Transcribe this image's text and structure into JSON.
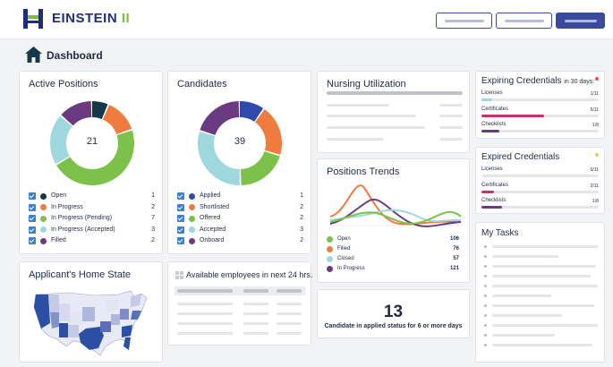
{
  "header": {
    "brand": "EINSTEIN",
    "brand_suffix": "II"
  },
  "page": {
    "title": "Dashboard"
  },
  "active_positions": {
    "title": "Active Positions",
    "total": "21",
    "items": [
      {
        "label": "Open",
        "value": "1",
        "color": "#14384a"
      },
      {
        "label": "In Progress",
        "value": "2",
        "color": "#ef7b3f"
      },
      {
        "label": "In Progress (Pending)",
        "value": "7",
        "color": "#7cc24a"
      },
      {
        "label": "In Progress (Accepted)",
        "value": "3",
        "color": "#9fd7df"
      },
      {
        "label": "Filled",
        "value": "2",
        "color": "#6b3a80"
      }
    ],
    "chart_data": {
      "type": "pie",
      "categories": [
        "Open",
        "In Progress",
        "In Progress (Pending)",
        "In Progress (Accepted)",
        "Filled"
      ],
      "values": [
        1,
        2,
        7,
        3,
        2
      ]
    }
  },
  "candidates": {
    "title": "Candidates",
    "total": "39",
    "items": [
      {
        "label": "Applied",
        "value": "1",
        "color": "#2f4aa8"
      },
      {
        "label": "Shortlisted",
        "value": "2",
        "color": "#ef7b3f"
      },
      {
        "label": "Offered",
        "value": "2",
        "color": "#7cc24a"
      },
      {
        "label": "Accepted",
        "value": "3",
        "color": "#9fd7df"
      },
      {
        "label": "Onboard",
        "value": "2",
        "color": "#6b3a80"
      }
    ],
    "chart_data": {
      "type": "pie",
      "categories": [
        "Applied",
        "Shortlisted",
        "Offered",
        "Accepted",
        "Onboard"
      ],
      "values": [
        1,
        2,
        2,
        3,
        2
      ]
    }
  },
  "nursing": {
    "title": "Nursing Utilization"
  },
  "trends": {
    "title": "Positions Trends",
    "items": [
      {
        "label": "Open",
        "value": "106",
        "color": "#7cc24a"
      },
      {
        "label": "Filled",
        "value": "76",
        "color": "#ef7b3f"
      },
      {
        "label": "Closed",
        "value": "57",
        "color": "#9fd7df"
      },
      {
        "label": "In Progress",
        "value": "121",
        "color": "#6b3a80"
      }
    ]
  },
  "home_state": {
    "title": "Applicant's Home State"
  },
  "available": {
    "title": "Available employees in next 24 hrs."
  },
  "kpi": {
    "number": "13",
    "label": "Candidate in applied status for 6 or more days"
  },
  "expiring": {
    "title": "Expiring Credentials",
    "subtitle": "in 30 days:",
    "dot_color": "#e8573c",
    "rows": [
      {
        "label": "Licenses",
        "value": "1/11",
        "fill": 0.09,
        "color": "#9fd7df"
      },
      {
        "label": "Certificates",
        "value": "5/11",
        "fill": 0.45,
        "color": "#c6336b"
      },
      {
        "label": "Checklists",
        "value": "1/8",
        "fill": 0.125,
        "color": "#6b3a80"
      }
    ]
  },
  "expired": {
    "title": "Expired Credentials",
    "dot_color": "#f4c36a",
    "rows": [
      {
        "label": "Licenses",
        "value": "0/11",
        "fill": 0,
        "color": "#9fd7df"
      },
      {
        "label": "Certificates",
        "value": "2/11",
        "fill": 0.18,
        "color": "#c6336b"
      },
      {
        "label": "Checklists",
        "value": "1/8",
        "fill": 0.125,
        "color": "#6b3a80"
      }
    ]
  },
  "tasks": {
    "title": "My Tasks"
  }
}
